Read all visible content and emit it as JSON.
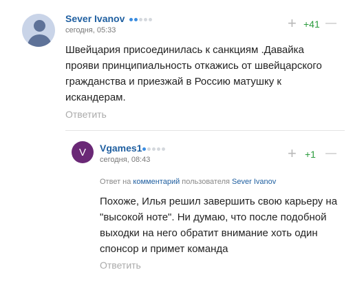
{
  "comments": [
    {
      "username": "Sever Ivanov",
      "avatar": "user-silhouette",
      "time": "сегодня, 05:33",
      "votes": "+41",
      "vote_up_symbol": "+",
      "vote_down_symbol": "—",
      "text": "Швейцария присоединилась к санкциям .Давайка прояви принципиальность откажись от швейцарского гражданства и приезжай в Россию матушку к искандерам.",
      "reply_label": "Ответить"
    },
    {
      "username": "Vgames1",
      "avatar_letter": "V",
      "time": "сегодня, 08:43",
      "votes": "+1",
      "vote_up_symbol": "+",
      "vote_down_symbol": "—",
      "reply_prefix": "Ответ на",
      "reply_link": "комментарий",
      "reply_mid": "пользователя",
      "reply_user": "Sever Ivanov",
      "text": "Похоже, Илья решил завершить свою карьеру на \"высокой ноте\". Ни думаю, что после подобной выходки на него обратит внимание хоть один спонсор и примет команда",
      "reply_label": "Ответить"
    }
  ],
  "colors": {
    "username": "#1f5fa0",
    "votes_positive": "#2a9b3c",
    "avatar_letter_bg": "#6a2876",
    "rating_dot_on": "#3a8ce0"
  }
}
